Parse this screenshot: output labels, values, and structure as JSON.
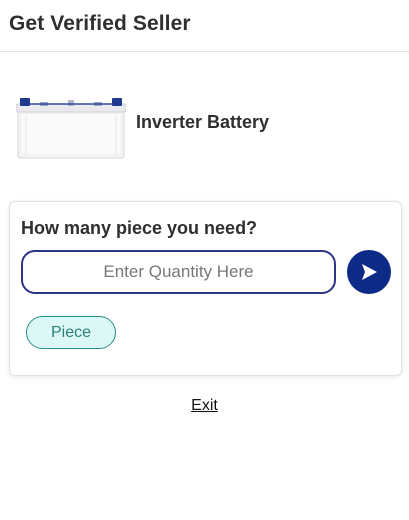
{
  "header": {
    "title": "Get Verified Seller"
  },
  "product": {
    "name": "Inverter Battery",
    "image_icon": "battery-icon"
  },
  "quantity_card": {
    "question": "How many piece you need?",
    "input_placeholder": "Enter Quantity Here",
    "input_value": "",
    "submit_icon": "send-arrow-icon",
    "unit_label": "Piece"
  },
  "footer": {
    "exit_label": "Exit"
  },
  "colors": {
    "accent_navy": "#0d2a86",
    "input_border": "#2d3585",
    "chip_border": "#2f8f87",
    "chip_bg": "#dcf8f6"
  }
}
